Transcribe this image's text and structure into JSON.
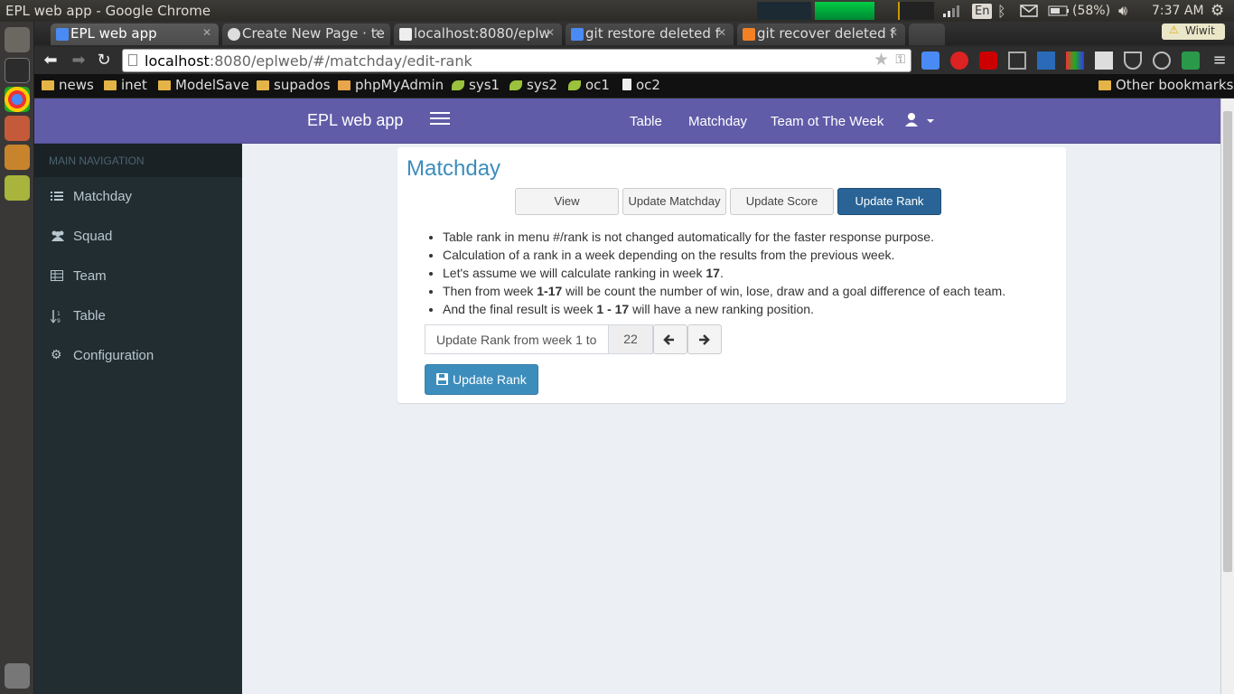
{
  "os": {
    "window_title": "EPL web app - Google Chrome",
    "keyboard_layout": "En",
    "battery": "(58%)",
    "clock": "7:37 AM"
  },
  "browser": {
    "tabs": [
      {
        "label": "EPL web app",
        "favicon": "google-g-icon",
        "active": true
      },
      {
        "label": "Create New Page · te",
        "favicon": "github-icon",
        "active": false
      },
      {
        "label": "localhost:8080/eplw",
        "favicon": "page-icon",
        "active": false
      },
      {
        "label": "git restore deleted f",
        "favicon": "google-g-icon",
        "active": false
      },
      {
        "label": "git recover deleted f",
        "favicon": "stackoverflow-icon",
        "active": false
      }
    ],
    "extension_tab": "Wiwit",
    "url_host": "localhost",
    "url_rest": ":8080/eplweb/#/matchday/edit-rank",
    "bookmarks": [
      {
        "label": "news",
        "icon": "folder-icon"
      },
      {
        "label": "inet",
        "icon": "folder-icon"
      },
      {
        "label": "ModelSave",
        "icon": "folder-icon"
      },
      {
        "label": "supados",
        "icon": "folder-icon"
      },
      {
        "label": "phpMyAdmin",
        "icon": "phpmyadmin-icon"
      },
      {
        "label": "sys1",
        "icon": "leaf-icon"
      },
      {
        "label": "sys2",
        "icon": "leaf-icon"
      },
      {
        "label": "oc1",
        "icon": "leaf-icon"
      },
      {
        "label": "oc2",
        "icon": "page-icon"
      }
    ],
    "other_bookmarks": "Other bookmarks"
  },
  "app": {
    "brand": "EPL web app",
    "nav": [
      "Table",
      "Matchday",
      "Team ot The Week"
    ],
    "sidebar_header": "MAIN NAVIGATION",
    "sidebar_items": [
      {
        "label": "Matchday",
        "icon": "list-icon"
      },
      {
        "label": "Squad",
        "icon": "users-icon"
      },
      {
        "label": "Team",
        "icon": "table-icon"
      },
      {
        "label": "Table",
        "icon": "sort-numeric-icon"
      },
      {
        "label": "Configuration",
        "icon": "gear-icon"
      }
    ]
  },
  "content": {
    "title": "Matchday",
    "tabs": [
      "View",
      "Update Matchday",
      "Update Score",
      "Update Rank"
    ],
    "active_tab": "Update Rank",
    "notes": [
      {
        "pre": "Table rank in menu #/rank is not changed automatically for the faster response purpose.",
        "bold": "",
        "post": ""
      },
      {
        "pre": "Calculation of a rank in a week depending on the results from the previous week.",
        "bold": "",
        "post": ""
      },
      {
        "pre": "Let's assume we will calculate ranking in week ",
        "bold": "17",
        "post": "."
      },
      {
        "pre": "Then from week ",
        "bold": "1-17",
        "post": " will be count the number of win, lose, draw and a goal difference of each team."
      },
      {
        "pre": "And the final result is week ",
        "bold": "1 - 17",
        "post": " will have a new ranking position."
      }
    ],
    "stepper_label": "Update Rank from week 1 to",
    "stepper_value": "22",
    "submit_label": "Update Rank"
  }
}
